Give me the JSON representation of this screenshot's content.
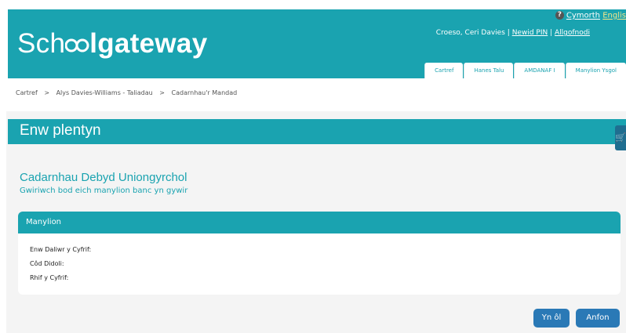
{
  "header": {
    "logo": {
      "part1": "Sch",
      "part2": "lgateway"
    },
    "help_label": "Cymorth",
    "language_label": "Englis",
    "welcome_text": "Croeso, Ceri Davies |",
    "change_pin_label": "Newid PIN",
    "separator": "|",
    "logout_label": "Allgofnodi",
    "tabs": [
      {
        "label": "Cartref"
      },
      {
        "label": "Hanes Talu"
      },
      {
        "label": "AMDANAF I"
      },
      {
        "label": "Manylion Ysgol"
      }
    ]
  },
  "breadcrumb": {
    "items": [
      "Cartref",
      ">",
      "Alys Davies-Williams - Taliadau",
      ">",
      "Cadarnhau'r Mandad"
    ]
  },
  "page": {
    "title": "Enw plentyn",
    "heading": "Cadarnhau Debyd Uniongyrchol",
    "subheading": "Gwiriwch bod eich manylion banc yn gywir"
  },
  "panel": {
    "title": "Manylion",
    "fields": [
      {
        "label": "Enw Daliwr y Cyfrif:"
      },
      {
        "label": "Côd Didoli:"
      },
      {
        "label": "Rhif y Cyfrif:"
      }
    ]
  },
  "buttons": {
    "back_label": "Yn ôl",
    "send_label": "Anfon"
  },
  "colors": {
    "primary": "#1aa3b0",
    "button": "#2a79b6",
    "background": "#f4f4f4"
  }
}
